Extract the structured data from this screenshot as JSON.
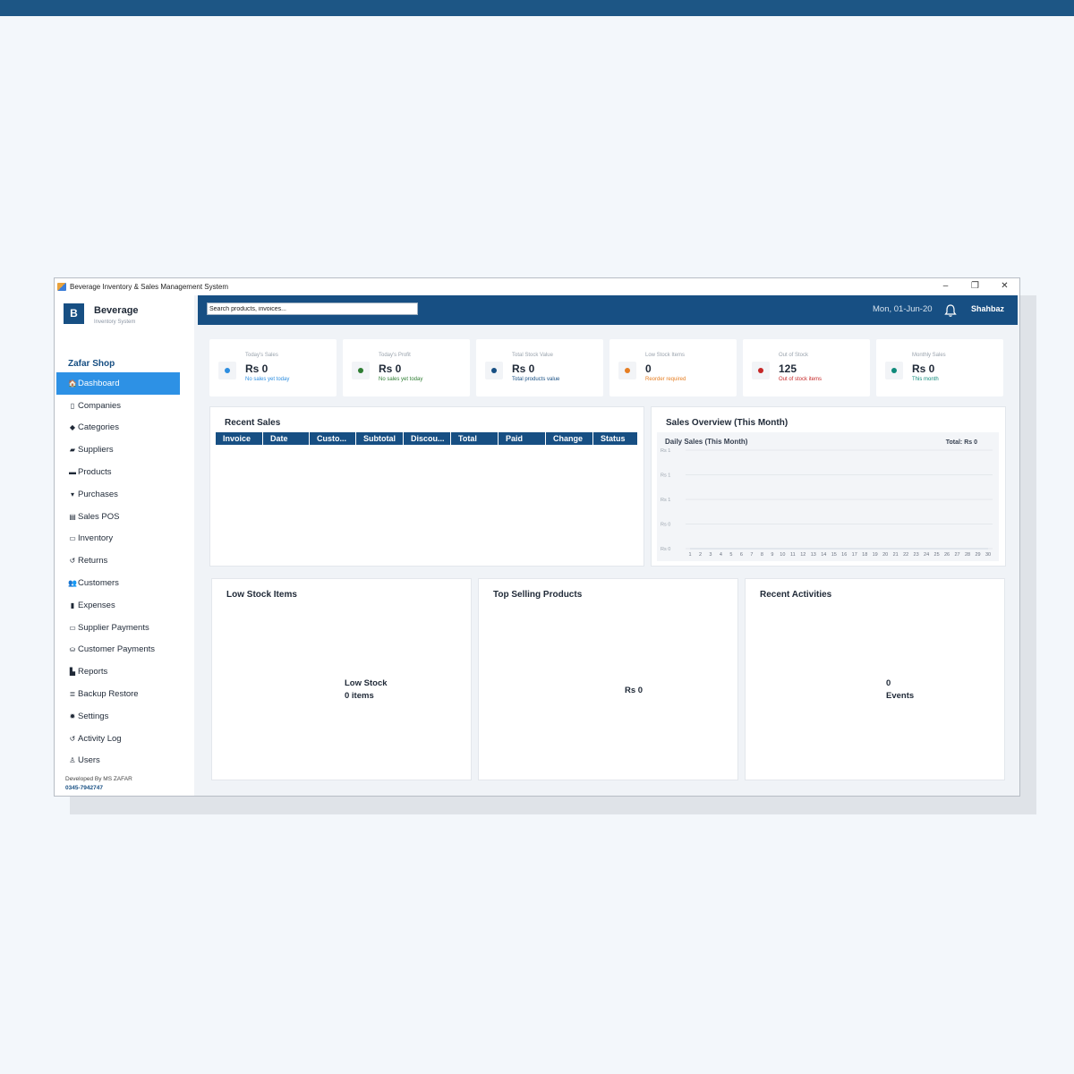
{
  "window": {
    "title": "Beverage Inventory & Sales Management System",
    "controls": [
      "–",
      "❐",
      "✕"
    ]
  },
  "brand": {
    "logo_letter": "B",
    "name": "Beverage",
    "subtitle": "Inventory System"
  },
  "shop_name": "Zafar Shop",
  "sidebar": {
    "items": [
      {
        "label": "Dashboard",
        "icon": "home-icon",
        "glyph": "🏠",
        "active": true
      },
      {
        "label": "Companies",
        "icon": "building-icon",
        "glyph": "▯"
      },
      {
        "label": "Categories",
        "icon": "tag-icon",
        "glyph": "◆"
      },
      {
        "label": "Suppliers",
        "icon": "truck-icon",
        "glyph": "▰"
      },
      {
        "label": "Products",
        "icon": "box-icon",
        "glyph": "▬"
      },
      {
        "label": "Purchases",
        "icon": "cart-icon",
        "glyph": "▾"
      },
      {
        "label": "Sales POS",
        "icon": "register-icon",
        "glyph": "▤"
      },
      {
        "label": "Inventory",
        "icon": "warehouse-icon",
        "glyph": "▭"
      },
      {
        "label": "Returns",
        "icon": "undo-icon",
        "glyph": "↺"
      },
      {
        "label": "Customers",
        "icon": "users-icon",
        "glyph": "👥"
      },
      {
        "label": "Expenses",
        "icon": "receipt-icon",
        "glyph": "▮"
      },
      {
        "label": "Supplier Payments",
        "icon": "credit-card-icon",
        "glyph": "▭"
      },
      {
        "label": "Customer Payments",
        "icon": "hand-money-icon",
        "glyph": "⛀"
      },
      {
        "label": "Reports",
        "icon": "chart-icon",
        "glyph": "▙"
      },
      {
        "label": "Backup  Restore",
        "icon": "database-icon",
        "glyph": "≣"
      },
      {
        "label": "Settings",
        "icon": "gear-icon",
        "glyph": "✹"
      },
      {
        "label": "Activity Log",
        "icon": "history-icon",
        "glyph": "↺"
      },
      {
        "label": "Users",
        "icon": "user-icon",
        "glyph": "♙"
      }
    ]
  },
  "footer": {
    "developer": "Developed By MS ZAFAR",
    "phone": "0345-7942747"
  },
  "header": {
    "search_placeholder": "Search products, invoices...",
    "date": "Mon, 01-Jun-20",
    "user": "Shahbaz"
  },
  "cards": [
    {
      "label": "Today's Sales",
      "value": "Rs 0",
      "sub": "No sales yet today",
      "color": "#2d8ee0",
      "sub_color": "#2d8ee0"
    },
    {
      "label": "Today's Profit",
      "value": "Rs 0",
      "sub": "No sales yet today",
      "color": "#2e7d32",
      "sub_color": "#2e7d32"
    },
    {
      "label": "Total Stock Value",
      "value": "Rs 0",
      "sub": "Total products value",
      "color": "#174f83",
      "sub_color": "#174f83"
    },
    {
      "label": "Low Stock Items",
      "value": "0",
      "sub": "Reorder required",
      "color": "#e67e22",
      "sub_color": "#e67e22"
    },
    {
      "label": "Out of Stock",
      "value": "125",
      "sub": "Out of stock items",
      "color": "#c62828",
      "sub_color": "#c62828"
    },
    {
      "label": "Monthly Sales",
      "value": "Rs 0",
      "sub": "This month",
      "color": "#0f8a7a",
      "sub_color": "#0f8a7a"
    }
  ],
  "recent_sales": {
    "title": "Recent Sales",
    "columns": [
      "Invoice",
      "Date",
      "Custo...",
      "Subtotal",
      "Discou...",
      "Total",
      "Paid",
      "Change",
      "Status"
    ],
    "rows": []
  },
  "sales_overview": {
    "title": "Sales Overview (This Month)"
  },
  "chart_data": {
    "type": "line",
    "title": "Daily Sales (This Month)",
    "total_label": "Total: Rs 0",
    "y_tick_labels": [
      "Rs 1",
      "Rs 1",
      "Rs 1",
      "Rs 0",
      "Rs 0"
    ],
    "x": [
      1,
      2,
      3,
      4,
      5,
      6,
      7,
      8,
      9,
      10,
      11,
      12,
      13,
      14,
      15,
      16,
      17,
      18,
      19,
      20,
      21,
      22,
      23,
      24,
      25,
      26,
      27,
      28,
      29,
      30
    ],
    "series": [
      {
        "values": [
          0,
          0,
          0,
          0,
          0,
          0,
          0,
          0,
          0,
          0,
          0,
          0,
          0,
          0,
          0,
          0,
          0,
          0,
          0,
          0,
          0,
          0,
          0,
          0,
          0,
          0,
          0,
          0,
          0,
          0
        ]
      }
    ],
    "grid": true,
    "xlabel": "",
    "ylabel": ""
  },
  "low_stock": {
    "title": "Low Stock Items",
    "line1": "Low Stock",
    "line2": "0 items"
  },
  "top_selling": {
    "title": "Top Selling Products",
    "value": "Rs 0"
  },
  "recent_activities": {
    "title": "Recent Activities",
    "line1": "0",
    "line2": "Events"
  }
}
